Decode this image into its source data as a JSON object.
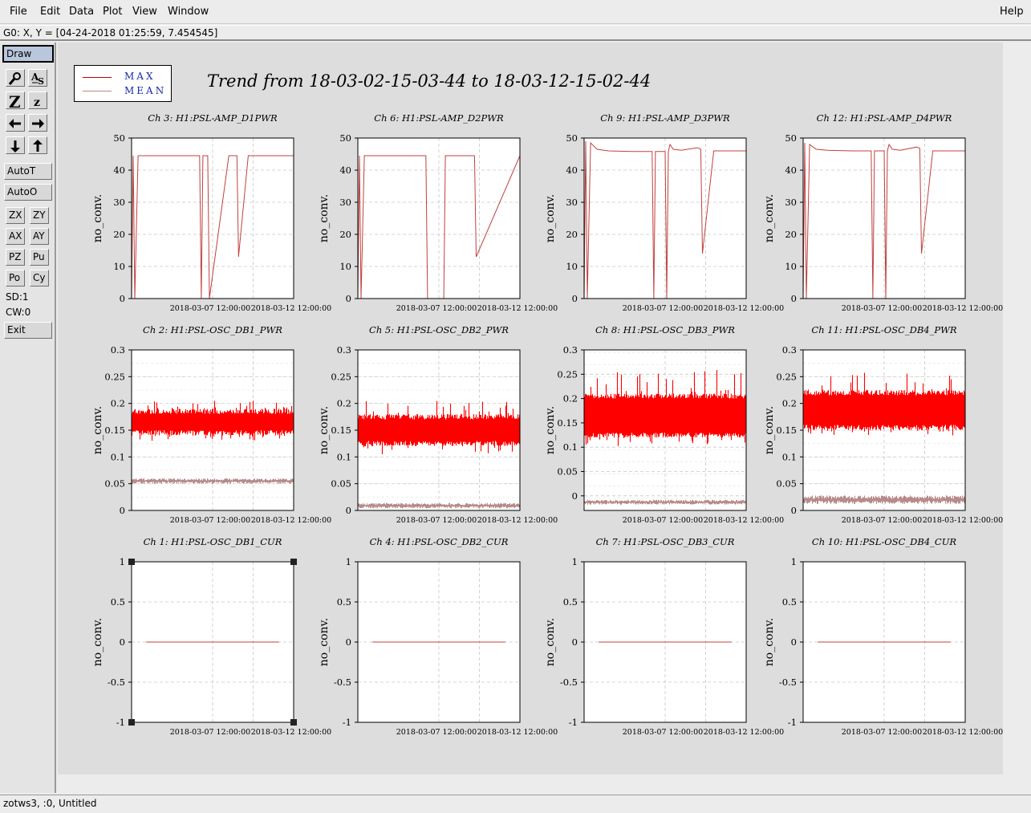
{
  "menu": {
    "left": [
      "File",
      "Edit",
      "Data",
      "Plot",
      "View",
      "Window"
    ],
    "help": "Help"
  },
  "coord_readout": "G0: X, Y = [04-24-2018 01:25:59, 7.454545]",
  "toolbar": {
    "draw": "Draw",
    "auto_t": "AutoT",
    "auto_o": "AutoO",
    "zx": "ZX",
    "zy": "ZY",
    "ax": "AX",
    "ay": "AY",
    "pz": "PZ",
    "pu": "Pu",
    "po": "Po",
    "cy": "Cy",
    "sd": "SD:1",
    "cw": "CW:0",
    "exit": "Exit",
    "icons": [
      "magnifier-icon",
      "text-as-icon",
      "zoom-big-z-icon",
      "zoom-small-z-icon",
      "arrow-left-icon",
      "arrow-right-icon",
      "arrow-down-icon",
      "arrow-up-icon"
    ]
  },
  "status": "zotws3, :0, Untitled",
  "legend": {
    "max": "MAX",
    "mean": "MEAN",
    "max_color": "#c00000",
    "mean_color": "#b88a8a"
  },
  "title": "Trend from 18-03-02-15-03-44 to 18-03-12-15-02-44",
  "colors": {
    "max": "#ff0000",
    "max_line": "#c04040",
    "mean": "#b88a8a",
    "grid": "#c8c8c8"
  },
  "chart_data": [
    {
      "type": "line",
      "title": "Ch 3: H1:PSL-AMP_D1PWR",
      "ylabel": "no_conv.",
      "ylim": [
        0,
        50
      ],
      "yticks": [
        "50",
        "40",
        "30",
        "20",
        "10",
        "0"
      ],
      "xticks": [
        "2018-03-07 12:00:00",
        "2018-03-12 12:00:00"
      ],
      "kind": "power",
      "series": [
        {
          "name": "MAX",
          "x": [
            0.0,
            0.01,
            0.02,
            0.04,
            0.42,
            0.43,
            0.44,
            0.47,
            0.48,
            0.6,
            0.62,
            0.65,
            0.66,
            0.72,
            0.73,
            1.0
          ],
          "y": [
            0,
            44.5,
            0,
            44.5,
            44.5,
            0,
            44.5,
            44.5,
            0,
            44.5,
            44.5,
            44.5,
            13,
            44.5,
            44.5,
            44.5
          ]
        }
      ]
    },
    {
      "type": "line",
      "title": "Ch 6: H1:PSL-AMP_D2PWR",
      "ylabel": "no_conv.",
      "ylim": [
        0,
        50
      ],
      "yticks": [
        "50",
        "40",
        "30",
        "20",
        "10",
        "0"
      ],
      "xticks": [
        "2018-03-07 12:00:00",
        "2018-03-12 12:00:00"
      ],
      "kind": "power",
      "series": [
        {
          "name": "MAX",
          "x": [
            0.0,
            0.01,
            0.02,
            0.04,
            0.42,
            0.43,
            0.44,
            0.53,
            0.54,
            0.72,
            0.73,
            1.0
          ],
          "y": [
            0,
            44.5,
            0,
            44.5,
            44.5,
            0,
            0,
            0,
            44.5,
            44.5,
            13,
            44.5
          ]
        }
      ]
    },
    {
      "type": "line",
      "title": "Ch 9: H1:PSL-AMP_D3PWR",
      "ylabel": "no_conv.",
      "ylim": [
        0,
        50
      ],
      "yticks": [
        "50",
        "40",
        "30",
        "20",
        "10",
        "0"
      ],
      "xticks": [
        "2018-03-07 12:00:00",
        "2018-03-12 12:00:00"
      ],
      "kind": "power",
      "series": [
        {
          "name": "MAX",
          "x": [
            0.0,
            0.01,
            0.02,
            0.04,
            0.08,
            0.15,
            0.3,
            0.42,
            0.43,
            0.44,
            0.5,
            0.51,
            0.52,
            0.53,
            0.55,
            0.6,
            0.7,
            0.72,
            0.73,
            0.8,
            0.9,
            1.0
          ],
          "y": [
            0,
            49,
            0,
            48.5,
            46.5,
            46,
            45.8,
            45.8,
            0,
            45.8,
            45.8,
            0,
            45.8,
            48,
            46.5,
            46.2,
            47,
            46.5,
            14,
            46,
            46,
            46
          ]
        }
      ]
    },
    {
      "type": "line",
      "title": "Ch 12: H1:PSL-AMP_D4PWR",
      "ylabel": "no_conv.",
      "ylim": [
        0,
        50
      ],
      "yticks": [
        "50",
        "40",
        "30",
        "20",
        "10",
        "0"
      ],
      "xticks": [
        "2018-03-07 12:00:00",
        "2018-03-12 12:00:00"
      ],
      "kind": "power",
      "series": [
        {
          "name": "MAX",
          "x": [
            0.0,
            0.01,
            0.02,
            0.04,
            0.08,
            0.15,
            0.3,
            0.42,
            0.43,
            0.44,
            0.5,
            0.51,
            0.52,
            0.53,
            0.55,
            0.6,
            0.7,
            0.72,
            0.73,
            0.8,
            0.9,
            1.0
          ],
          "y": [
            0,
            48.5,
            0,
            48,
            46.5,
            46.2,
            46,
            46,
            0,
            46,
            46,
            0,
            46,
            48,
            46.5,
            46.2,
            47.2,
            46.8,
            14,
            46,
            46,
            46
          ]
        }
      ]
    },
    {
      "type": "line",
      "title": "Ch 2: H1:PSL-OSC_DB1_PWR",
      "ylabel": "no_conv.",
      "ylim": [
        0,
        0.3
      ],
      "yticks": [
        "0.3",
        "0.25",
        "0.2",
        "0.15",
        "0.1",
        "0.05",
        "0"
      ],
      "xticks": [
        "2018-03-07 12:00:00",
        "2018-03-12 12:00:00"
      ],
      "kind": "noise",
      "series": [
        {
          "name": "MAX",
          "low": 0.14,
          "high": 0.19,
          "spike_low": 0.13,
          "spike_high": 0.205
        },
        {
          "name": "MEAN",
          "low": 0.05,
          "high": 0.06
        }
      ]
    },
    {
      "type": "line",
      "title": "Ch 5: H1:PSL-OSC_DB2_PWR",
      "ylabel": "no_conv.",
      "ylim": [
        0,
        0.3
      ],
      "yticks": [
        "0.3",
        "0.25",
        "0.2",
        "0.15",
        "0.1",
        "0.05",
        "0"
      ],
      "xticks": [
        "2018-03-07 12:00:00",
        "2018-03-12 12:00:00"
      ],
      "kind": "noise",
      "series": [
        {
          "name": "MAX",
          "low": 0.12,
          "high": 0.18,
          "spike_low": 0.105,
          "spike_high": 0.205
        },
        {
          "name": "MEAN",
          "low": 0.004,
          "high": 0.014
        }
      ]
    },
    {
      "type": "line",
      "title": "Ch 8: H1:PSL-OSC_DB3_PWR",
      "ylabel": "no_conv.",
      "ylim": [
        -0.03,
        0.3
      ],
      "yticks": [
        "0.3",
        "0.25",
        "0.2",
        "0.15",
        "0.1",
        "0.05",
        "0"
      ],
      "xticks": [
        "2018-03-07 12:00:00",
        "2018-03-12 12:00:00"
      ],
      "kind": "noise",
      "series": [
        {
          "name": "MAX",
          "low": 0.12,
          "high": 0.21,
          "spike_low": 0.1,
          "spike_high": 0.26
        },
        {
          "name": "MEAN",
          "low": -0.018,
          "high": -0.008
        }
      ]
    },
    {
      "type": "line",
      "title": "Ch 11: H1:PSL-OSC_DB4_PWR",
      "ylabel": "no_conv.",
      "ylim": [
        0,
        0.3
      ],
      "yticks": [
        "0.3",
        "0.25",
        "0.2",
        "0.15",
        "0.1",
        "0.05",
        "0"
      ],
      "xticks": [
        "2018-03-07 12:00:00",
        "2018-03-12 12:00:00"
      ],
      "kind": "noise",
      "series": [
        {
          "name": "MAX",
          "low": 0.15,
          "high": 0.225,
          "spike_low": 0.14,
          "spike_high": 0.26
        },
        {
          "name": "MEAN",
          "low": 0.012,
          "high": 0.028
        }
      ]
    },
    {
      "type": "line",
      "title": "Ch 1: H1:PSL-OSC_DB1_CUR",
      "ylabel": "no_conv.",
      "ylim": [
        -1,
        1
      ],
      "yticks": [
        "1",
        "0.5",
        "0",
        "-0.5",
        "-1"
      ],
      "xticks": [
        "2018-03-07 12:00:00",
        "2018-03-12 12:00:00"
      ],
      "kind": "flat",
      "selected": true,
      "series": [
        {
          "name": "MAX",
          "x": [
            0.09,
            0.91
          ],
          "y": [
            0,
            0
          ]
        }
      ]
    },
    {
      "type": "line",
      "title": "Ch 4: H1:PSL-OSC_DB2_CUR",
      "ylabel": "no_conv.",
      "ylim": [
        -1,
        1
      ],
      "yticks": [
        "1",
        "0.5",
        "0",
        "-0.5",
        "-1"
      ],
      "xticks": [
        "2018-03-07 12:00:00",
        "2018-03-12 12:00:00"
      ],
      "kind": "flat",
      "series": [
        {
          "name": "MAX",
          "x": [
            0.09,
            0.91
          ],
          "y": [
            0,
            0
          ]
        }
      ]
    },
    {
      "type": "line",
      "title": "Ch 7: H1:PSL-OSC_DB3_CUR",
      "ylabel": "no_conv.",
      "ylim": [
        -1,
        1
      ],
      "yticks": [
        "1",
        "0.5",
        "0",
        "-0.5",
        "-1"
      ],
      "xticks": [
        "2018-03-07 12:00:00",
        "2018-03-12 12:00:00"
      ],
      "kind": "flat",
      "series": [
        {
          "name": "MAX",
          "x": [
            0.09,
            0.91
          ],
          "y": [
            0,
            0
          ]
        }
      ]
    },
    {
      "type": "line",
      "title": "Ch 10: H1:PSL-OSC_DB4_CUR",
      "ylabel": "no_conv.",
      "ylim": [
        -1,
        1
      ],
      "yticks": [
        "1",
        "0.5",
        "0",
        "-0.5",
        "-1"
      ],
      "xticks": [
        "2018-03-07 12:00:00",
        "2018-03-12 12:00:00"
      ],
      "kind": "flat",
      "series": [
        {
          "name": "MAX",
          "x": [
            0.09,
            0.91
          ],
          "y": [
            0,
            0
          ]
        }
      ]
    }
  ]
}
